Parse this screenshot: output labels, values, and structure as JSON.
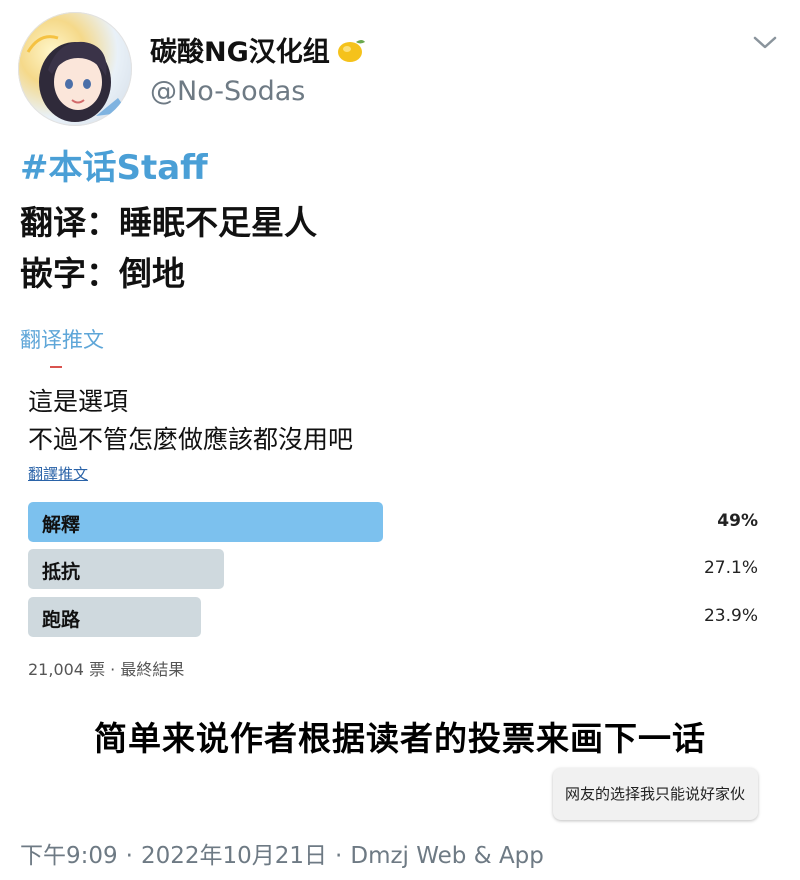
{
  "author": {
    "display_name": "碳酸NG汉化组",
    "handle": "@No-Sodas"
  },
  "tweet": {
    "hashtag": "#本话Staff",
    "line1": "翻译：睡眠不足星人",
    "line2": "嵌字：倒地",
    "translate_label": "翻译推文"
  },
  "quoted_poll": {
    "text_line1": "這是選項",
    "text_line2": "不過不管怎麼做應該都沒用吧",
    "translate_label": "翻譯推文",
    "options": [
      {
        "label": "解釋",
        "percent_text": "49%",
        "percent": 49
      },
      {
        "label": "抵抗",
        "percent_text": "27.1%",
        "percent": 27.1
      },
      {
        "label": "跑路",
        "percent_text": "23.9%",
        "percent": 23.9
      }
    ],
    "footer": "21,004 票 · 最終結果"
  },
  "caption": "简单来说作者根据读者的投票来画下一话",
  "comment": "网友的选择我只能说好家伙",
  "meta": {
    "time": "下午9:09",
    "date": "2022年10月21日",
    "source": "Dmzj Web & App"
  },
  "colors": {
    "hashtag": "#4a9fd6",
    "poll_leader": "#7cc1ee",
    "poll_other": "#cfd9de",
    "muted_text": "#6e7a84"
  },
  "icons": [
    "avatar",
    "lemon-icon",
    "chevron-down-icon"
  ]
}
